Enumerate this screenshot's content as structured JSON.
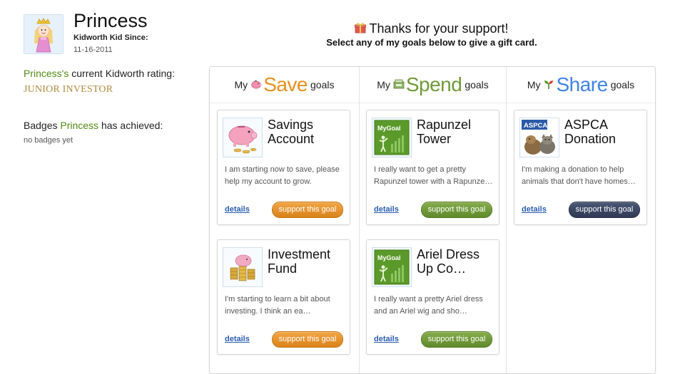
{
  "profile": {
    "name": "Princess",
    "since_label": "Kidworth Kid Since:",
    "since_date": "11-16-2011",
    "rating_name": "Princess's",
    "rating_text": " current Kidworth rating:",
    "rating_value": "JUNIOR INVESTOR",
    "badges_prefix": "Badges ",
    "badges_name": "Princess",
    "badges_suffix": " has achieved:",
    "no_badges": "no badges yet"
  },
  "header": {
    "thanks": "Thanks for your support!",
    "select_text": "Select any of my goals below to give a gift card."
  },
  "columns": [
    {
      "my": "My",
      "big": "Save",
      "goals": "goals",
      "icon": "piggy-bank-icon",
      "color": "#e8901c"
    },
    {
      "my": "My",
      "big": "Spend",
      "goals": "goals",
      "icon": "cash-register-icon",
      "color": "#6f9a37"
    },
    {
      "my": "My",
      "big": "Share",
      "goals": "goals",
      "icon": "seedling-icon",
      "color": "#3f84e5"
    }
  ],
  "goals": {
    "save": [
      {
        "title": "Savings Account",
        "desc": "I am starting now to save, please help my account to grow.",
        "details": "details",
        "button": "support this goal"
      },
      {
        "title": "Investment Fund",
        "desc": "I'm starting to learn a bit about investing. I think an ea…",
        "details": "details",
        "button": "support this goal"
      }
    ],
    "spend": [
      {
        "title": "Rapunzel Tower",
        "thumb_text": "MyGoal",
        "desc": "I really want to get a pretty Rapunzel tower with a Rapunze…",
        "details": "details",
        "button": "support this goal"
      },
      {
        "title": "Ariel Dress Up Co…",
        "thumb_text": "MyGoal",
        "desc": "I really want a pretty Ariel dress and an Ariel wig and sho…",
        "details": "details",
        "button": "support this goal"
      }
    ],
    "share": [
      {
        "title": "ASPCA Donation",
        "thumb_text": "ASPCA",
        "desc": "I'm making a donation to help animals that don't have homes…",
        "details": "details",
        "button": "support this goal"
      }
    ]
  },
  "colors": {
    "save_button": "#e8901c",
    "spend_button": "#6f9a37",
    "share_button": "#2e3a55",
    "link": "#2a5db0",
    "name_green": "#4f8a10",
    "rating_gold": "#b08a3e"
  }
}
